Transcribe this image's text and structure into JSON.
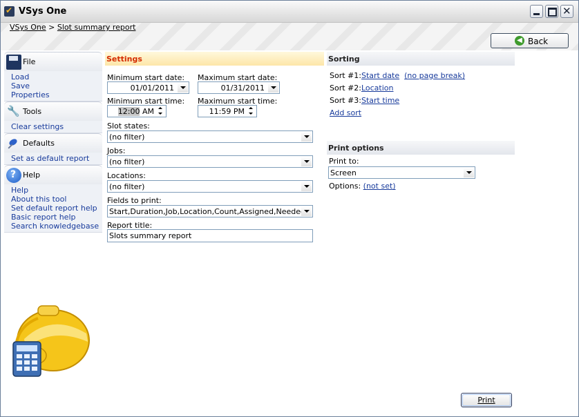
{
  "window": {
    "title": "VSys One"
  },
  "breadcrumb": {
    "root": "VSys One",
    "separator": ">",
    "current": "Slot summary report"
  },
  "back_button": {
    "label": "Back"
  },
  "sidebar": {
    "sections": [
      {
        "title": "File",
        "icon": "floppy-disk-icon",
        "items": [
          "Load",
          "Save",
          "Properties"
        ]
      },
      {
        "title": "Tools",
        "icon": "wrench-icon",
        "items": [
          "Clear settings"
        ]
      },
      {
        "title": "Defaults",
        "icon": "pushpin-icon",
        "items": [
          "Set as default report"
        ]
      },
      {
        "title": "Help",
        "icon": "help-icon",
        "items": [
          "Help",
          "About this tool",
          "Set default report help",
          "Basic report help",
          "Search knowledgebase"
        ]
      }
    ]
  },
  "settings": {
    "header": "Settings",
    "min_start_date_label": "Minimum start date:",
    "min_start_date": "01/01/2011",
    "max_start_date_label": "Maximum start date:",
    "max_start_date": "01/31/2011",
    "min_start_time_label": "Minimum start time:",
    "min_start_time_hour": "12:00",
    "min_start_time_ampm": "AM",
    "max_start_time_label": "Maximum start time:",
    "max_start_time": "11:59 PM",
    "slot_states_label": "Slot states:",
    "slot_states": "(no filter)",
    "jobs_label": "Jobs:",
    "jobs": "(no filter)",
    "locations_label": "Locations:",
    "locations": "(no filter)",
    "fields_label": "Fields to print:",
    "fields": "Start,Duration,Job,Location,Count,Assigned,Needed (new",
    "report_title_label": "Report title:",
    "report_title": "Slots summary report"
  },
  "sorting": {
    "header": "Sorting",
    "sort1_label": "Sort #1:",
    "sort1": "Start date",
    "sort1_extra": "(no page break)",
    "sort2_label": "Sort #2:",
    "sort2": "Location",
    "sort3_label": "Sort #3:",
    "sort3": "Start time",
    "add_sort": "Add sort"
  },
  "print_options": {
    "header": "Print options",
    "print_to_label": "Print to:",
    "print_to": "Screen",
    "options_label": "Options:",
    "options_value": "(not set)"
  },
  "print_button": {
    "label": "Print"
  },
  "colors": {
    "settings_header_text": "#d42c00",
    "link": "#173a9b",
    "back_arrow": "#3f9b2e",
    "mascot_helmet": "#f5c51a"
  }
}
